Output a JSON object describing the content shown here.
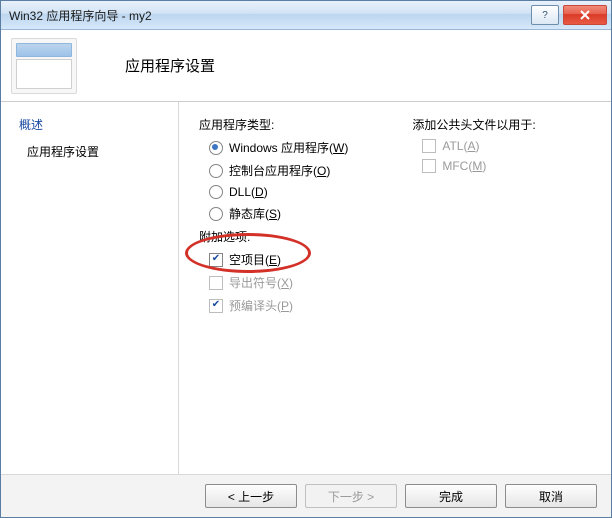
{
  "titlebar": {
    "title": "Win32 应用程序向导 - my2"
  },
  "banner": {
    "heading": "应用程序设置"
  },
  "sidebar": {
    "items": [
      {
        "label": "概述"
      },
      {
        "label": "应用程序设置"
      }
    ]
  },
  "content": {
    "app_type_label": "应用程序类型:",
    "app_type": [
      {
        "label": "Windows 应用程序",
        "key": "W",
        "selected": true
      },
      {
        "label": "控制台应用程序",
        "key": "O",
        "selected": false
      },
      {
        "label": "DLL",
        "key": "D",
        "selected": false
      },
      {
        "label": "静态库",
        "key": "S",
        "selected": false
      }
    ],
    "extra_label": "附加选项:",
    "extra": [
      {
        "label": "空项目",
        "key": "E",
        "checked": true,
        "enabled": true
      },
      {
        "label": "导出符号",
        "key": "X",
        "checked": false,
        "enabled": false
      },
      {
        "label": "预编译头",
        "key": "P",
        "checked": true,
        "enabled": false
      }
    ],
    "headers_label": "添加公共头文件以用于:",
    "headers": [
      {
        "label": "ATL",
        "key": "A",
        "checked": false,
        "enabled": false
      },
      {
        "label": "MFC",
        "key": "M",
        "checked": false,
        "enabled": false
      }
    ]
  },
  "footer": {
    "prev": "< 上一步",
    "next": "下一步 >",
    "finish": "完成",
    "cancel": "取消"
  }
}
